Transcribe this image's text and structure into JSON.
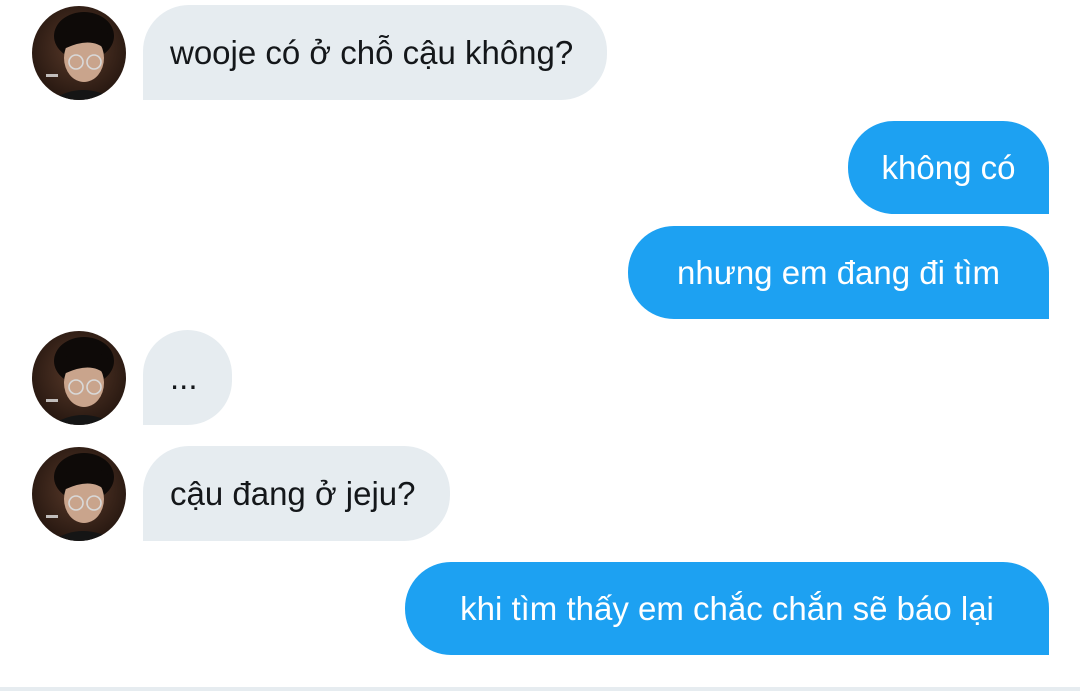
{
  "messages": [
    {
      "direction": "incoming",
      "text": "wooje có ở chỗ cậu không?",
      "avatar_icon": "profile-photo-icon"
    },
    {
      "direction": "outgoing",
      "text": "không có"
    },
    {
      "direction": "outgoing",
      "text": "nhưng em đang đi tìm"
    },
    {
      "direction": "incoming",
      "text": "...",
      "avatar_icon": "profile-photo-icon"
    },
    {
      "direction": "incoming",
      "text": "cậu đang ở jeju?",
      "avatar_icon": "profile-photo-icon"
    },
    {
      "direction": "outgoing",
      "text": "khi tìm thấy em chắc chắn sẽ báo lại"
    }
  ],
  "colors": {
    "outgoing_bubble": "#1da1f2",
    "incoming_bubble": "#e6ecf0",
    "incoming_text": "#14171a",
    "outgoing_text": "#ffffff"
  }
}
